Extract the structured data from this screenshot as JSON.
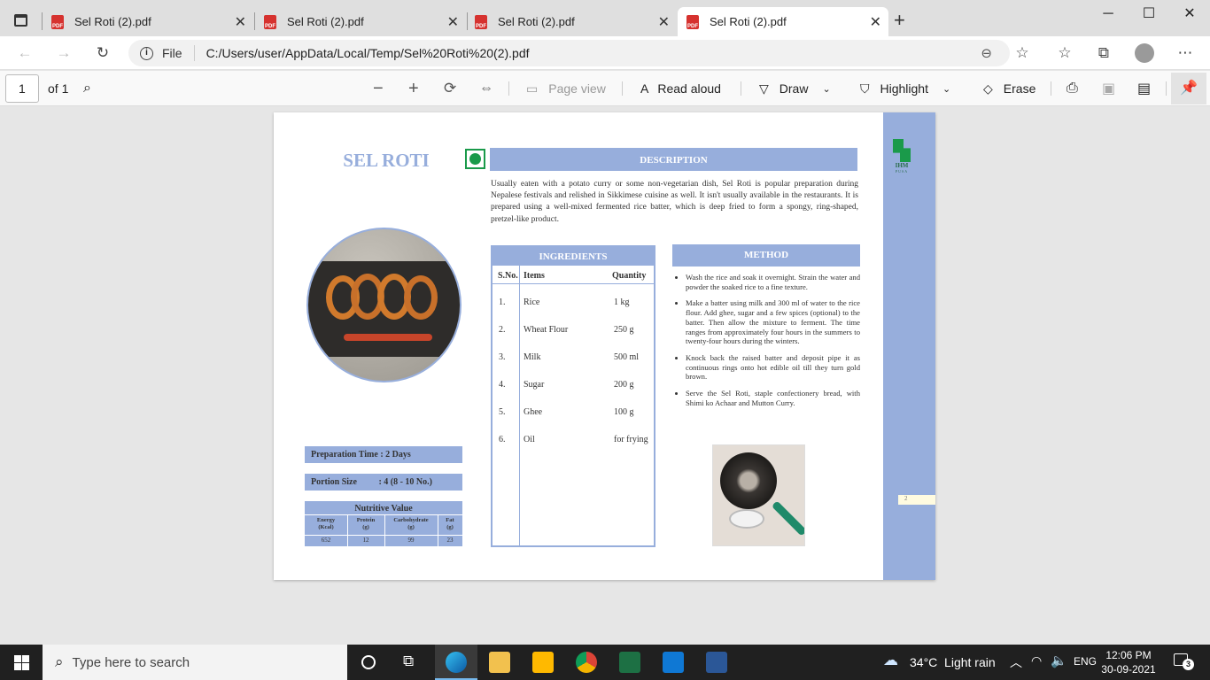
{
  "tabs": [
    {
      "title": "Sel Roti (2).pdf",
      "active": false
    },
    {
      "title": "Sel Roti (2).pdf",
      "active": false
    },
    {
      "title": "Sel Roti (2).pdf",
      "active": false
    },
    {
      "title": "Sel Roti (2).pdf",
      "active": true
    }
  ],
  "address": {
    "scheme_label": "File",
    "url": "C:/Users/user/AppData/Local/Temp/Sel%20Roti%20(2).pdf"
  },
  "pdf_toolbar": {
    "page_number": "1",
    "page_count": "of 1",
    "page_view": "Page view",
    "read_aloud": "Read aloud",
    "draw": "Draw",
    "highlight": "Highlight",
    "erase": "Erase"
  },
  "doc": {
    "title": "SEL ROTI",
    "description_heading": "DESCRIPTION",
    "description": "Usually eaten with a potato curry or some non-vegetarian dish, Sel Roti is popular preparation during Nepalese festivals and relished in Sikkimese cuisine as well. It isn't usually available in the restaurants. It is prepared using a well-mixed fermented rice batter, which is deep fried to form a spongy, ring-shaped, pretzel-like product.",
    "logo_text": "IHM",
    "logo_sub": "PUSA",
    "ingredients_heading": "INGREDIENTS",
    "ingredients_cols": [
      "S.No.",
      "Items",
      "Quantity"
    ],
    "ingredients": [
      {
        "no": "1.",
        "item": "Rice",
        "qty": "1 kg"
      },
      {
        "no": "2.",
        "item": "Wheat Flour",
        "qty": "250 g"
      },
      {
        "no": "3.",
        "item": "Milk",
        "qty": "500 ml"
      },
      {
        "no": "4.",
        "item": "Sugar",
        "qty": "200 g"
      },
      {
        "no": "5.",
        "item": "Ghee",
        "qty": "100 g"
      },
      {
        "no": "6.",
        "item": "Oil",
        "qty": "for frying"
      }
    ],
    "method_heading": "METHOD",
    "method": [
      "Wash the rice and soak it overnight. Strain the water and powder the soaked  rice to a fine texture.",
      "Make a batter using milk and 300 ml of water to the rice flour. Add ghee, sugar and a few spices (optional) to the batter. Then allow the mixture to ferment. The time ranges from approximately four hours in the summers to twenty-four hours during the winters.",
      "Knock back the raised batter and deposit pipe it as continuous rings onto hot edible oil till they turn gold brown.",
      "Serve the Sel Roti, staple confectionery bread, with Shimi ko Achaar and Mutton Curry."
    ],
    "prep_time": "Preparation Time : 2 Days",
    "portion_label": "Portion Size",
    "portion_value": ": 4 (8 - 10 No.)",
    "nutritive_heading": "Nutritive Value",
    "nutrition_cols": [
      [
        "Energy",
        "(Kcal)"
      ],
      [
        "Protein",
        "(g)"
      ],
      [
        "Carbohydrate",
        "(g)"
      ],
      [
        "Fat",
        "(g)"
      ]
    ],
    "nutrition_values": [
      "652",
      "12",
      "99",
      "23"
    ],
    "page_number": "2"
  },
  "taskbar": {
    "search_placeholder": "Type here to search",
    "weather": "34°C  Light rain",
    "lang": "ENG",
    "time": "12:06 PM",
    "date": "30-09-2021",
    "notifications": "3"
  },
  "colors": {
    "band": "#97aedc",
    "veg_mark": "#1a9a4a"
  }
}
